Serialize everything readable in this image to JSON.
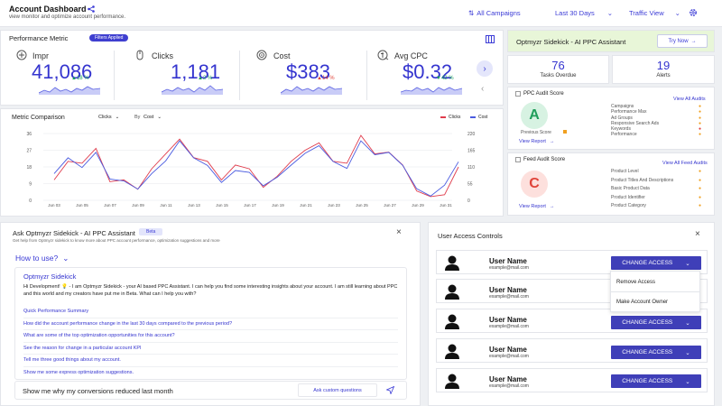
{
  "header": {
    "title": "Account Dashboard",
    "subtitle": "view monitor and optimize account performance.",
    "campaigns": "All Campaigns",
    "range": "Last 30 Days",
    "view": "Traffic View"
  },
  "performance": {
    "title": "Performance Metric",
    "filters": "Filters Applied",
    "metrics": [
      {
        "label": "Impr",
        "value": "41,086",
        "delta": "▲18 %",
        "dir": "up"
      },
      {
        "label": "Clicks",
        "value": "1,181",
        "delta": "▲2 %",
        "dir": "up"
      },
      {
        "label": "Cost",
        "value": "$383",
        "delta": "▲14 %",
        "dir": "down"
      },
      {
        "label": "Avg CPC",
        "value": "$0.32",
        "delta": "▼42 %",
        "dir": "up"
      }
    ]
  },
  "sidekick_banner": {
    "title": "Optmyzr Sidekick - AI PPC Assistant",
    "cta": "Try Now"
  },
  "stats": {
    "tasks_value": "76",
    "tasks_label": "Tasks Overdue",
    "alerts_value": "19",
    "alerts_label": "Alerts"
  },
  "ppc_audit": {
    "title": "PPC Audit Score",
    "grade": "A",
    "prev": "Previous Score",
    "view_report": "View Report",
    "view_all": "View All Audits",
    "items": [
      "Campaigns",
      "Performance Max",
      "Ad Groups",
      "Responsive Search Ads",
      "Keywords",
      "Performance"
    ]
  },
  "feed_audit": {
    "title": "Feed Audit Score",
    "grade": "C",
    "view_report": "View Report",
    "view_all": "View All Feed Audits",
    "items": [
      "Product Level",
      "Product Titles And Descriptions",
      "Basic Product Data",
      "Product Identifier",
      "Product Category"
    ]
  },
  "comparison": {
    "title": "Metric Comparison",
    "select1": "Clicks",
    "by": "By",
    "select2": "Cost",
    "legend1": "Clicks",
    "legend2": "Cost"
  },
  "chart_data": {
    "type": "line",
    "x": [
      "Jun 03",
      "Jun 05",
      "Jun 07",
      "Jun 09",
      "Jun 11",
      "Jun 13",
      "Jun 15",
      "Jun 17",
      "Jun 19",
      "Jun 21",
      "Jun 23",
      "Jun 25",
      "Jun 27",
      "Jun 29",
      "Jun 31"
    ],
    "left_ticks": [
      "0",
      "9",
      "18",
      "27",
      "36"
    ],
    "right_ticks": [
      "0",
      "55",
      "110",
      "165",
      "220"
    ],
    "ylim_left": [
      0,
      36
    ],
    "ylim_right": [
      0,
      220
    ],
    "series": [
      {
        "name": "Clicks",
        "axis": "left",
        "color": "#e03c4c",
        "values": [
          11,
          21,
          20,
          28,
          10,
          11,
          6,
          17,
          25,
          33,
          23,
          21,
          11,
          19,
          17,
          7,
          13,
          21,
          27,
          31,
          21,
          20,
          35,
          25,
          26,
          19,
          5,
          2,
          3,
          18
        ]
      },
      {
        "name": "Cost",
        "axis": "right",
        "color": "#4a5be0",
        "values": [
          88,
          140,
          108,
          158,
          70,
          64,
          37,
          88,
          130,
          196,
          140,
          115,
          59,
          98,
          92,
          48,
          76,
          116,
          155,
          180,
          128,
          105,
          196,
          150,
          158,
          115,
          38,
          14,
          50,
          127
        ]
      }
    ]
  },
  "assistant": {
    "title": "Ask Optmyzr Sidekick - AI PPC Assistant",
    "badge": "Beta",
    "sub": "Get help from Optmyzr sidekick to know more about PPC account performance, optimization suggestions and more",
    "how": "How to use?",
    "name": "Optmyzr Sidekick",
    "message": "Hi Development! 💡 - I am Optmyzr Sidekick - your AI based PPC Assistant. I can help you find some interesting insights about your account. I am still learning about PPC and this world and my creators have put me in Beta. What can I help you with?",
    "suggestions": [
      "Quick Performance Summary",
      "How did the account performance change in the last 30 days compared to the previous period?",
      "What are some of the top optimization opportunities for this account?",
      "See the reason for change in a particular account KPI",
      "Tell me three good things about my account.",
      "Show me some express optimization suggestions."
    ],
    "input": "Show me why my conversions reduced last month",
    "custom": "Ask custom questions"
  },
  "user_access": {
    "title": "User Access Controls",
    "change_label": "CHANGE ACCESS",
    "users": [
      {
        "name": "User Name",
        "email": "example@mail.com"
      },
      {
        "name": "User Name",
        "email": "example@mail.com"
      },
      {
        "name": "User Name",
        "email": "example@mail.com"
      },
      {
        "name": "User Name",
        "email": "example@mail.com"
      },
      {
        "name": "User Name",
        "email": "example@mail.com"
      }
    ],
    "menu": [
      "Remove Access",
      "Make Account Owner"
    ]
  }
}
